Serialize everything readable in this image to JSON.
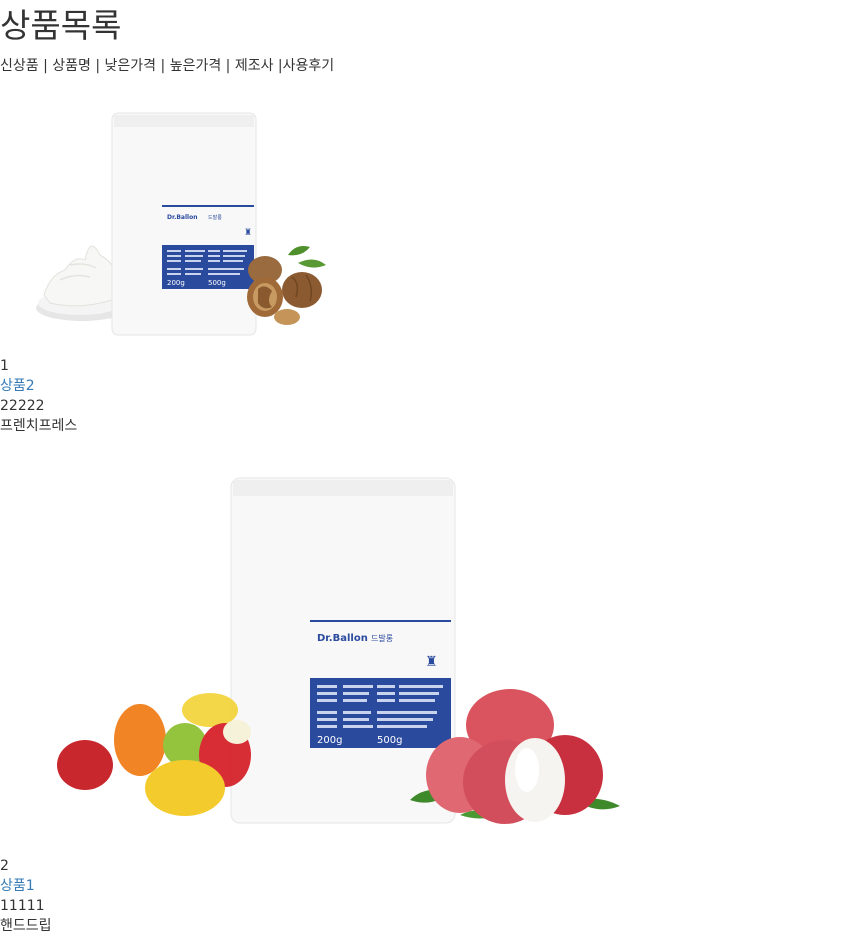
{
  "page": {
    "title": "상품목록"
  },
  "sort_bar": {
    "items": [
      "신상품",
      "상품명",
      "낮은가격",
      "높은가격",
      "제조사",
      "사용후기"
    ],
    "separator": " | ",
    "last_separator": " |"
  },
  "products": [
    {
      "number": "1",
      "name": "상품2",
      "price": "22222",
      "category": "프렌치프레스",
      "image": {
        "brand": "Dr.Ballon",
        "brand_sub": "드발롱",
        "weight_left": "200g",
        "weight_right": "500g",
        "accent_color": "#2a4a9e",
        "scene": "pouch-with-whipped-cream-and-walnuts"
      }
    },
    {
      "number": "2",
      "name": "상품1",
      "price": "11111",
      "category": "핸드드립",
      "image": {
        "brand": "Dr.Ballon",
        "brand_sub": "드발롱",
        "weight_left": "200g",
        "weight_right": "500g",
        "accent_color": "#2a4a9e",
        "scene": "pouch-with-gummy-bears-and-lychees"
      }
    }
  ]
}
